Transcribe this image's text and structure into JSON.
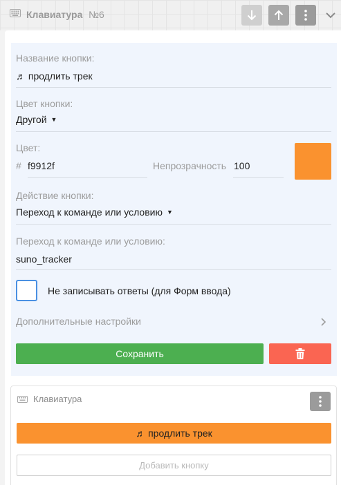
{
  "header": {
    "title": "Клавиатура",
    "number": "№6"
  },
  "form": {
    "button_name_label": "Название кнопки:",
    "button_name_value": "♬ продлить трек",
    "button_color_label": "Цвет кнопки:",
    "button_color_value": "Другой",
    "color_label": "Цвет:",
    "color_hash": "#",
    "color_hex_value": "f9912f",
    "opacity_label": "Непрозрачность",
    "opacity_value": "100",
    "swatch_color": "#fa922f",
    "action_label": "Действие кнопки:",
    "action_value": "Переход к команде или условию",
    "goto_label": "Переход к команде или условию:",
    "goto_value": "suno_tracker",
    "checkbox_label": "Не записывать ответы (для Форм ввода)",
    "checkbox_checked": false,
    "advanced_label": "Дополнительные настройки",
    "save_label": "Сохранить"
  },
  "keyboard_preview": {
    "title": "Клавиатура",
    "key_label": "♬ продлить трек",
    "add_button_label": "Добавить кнопку"
  },
  "colors": {
    "save": "#4caf50",
    "delete": "#fa6552",
    "accent_blue": "#4a90e2",
    "key_orange": "#fa922f"
  }
}
